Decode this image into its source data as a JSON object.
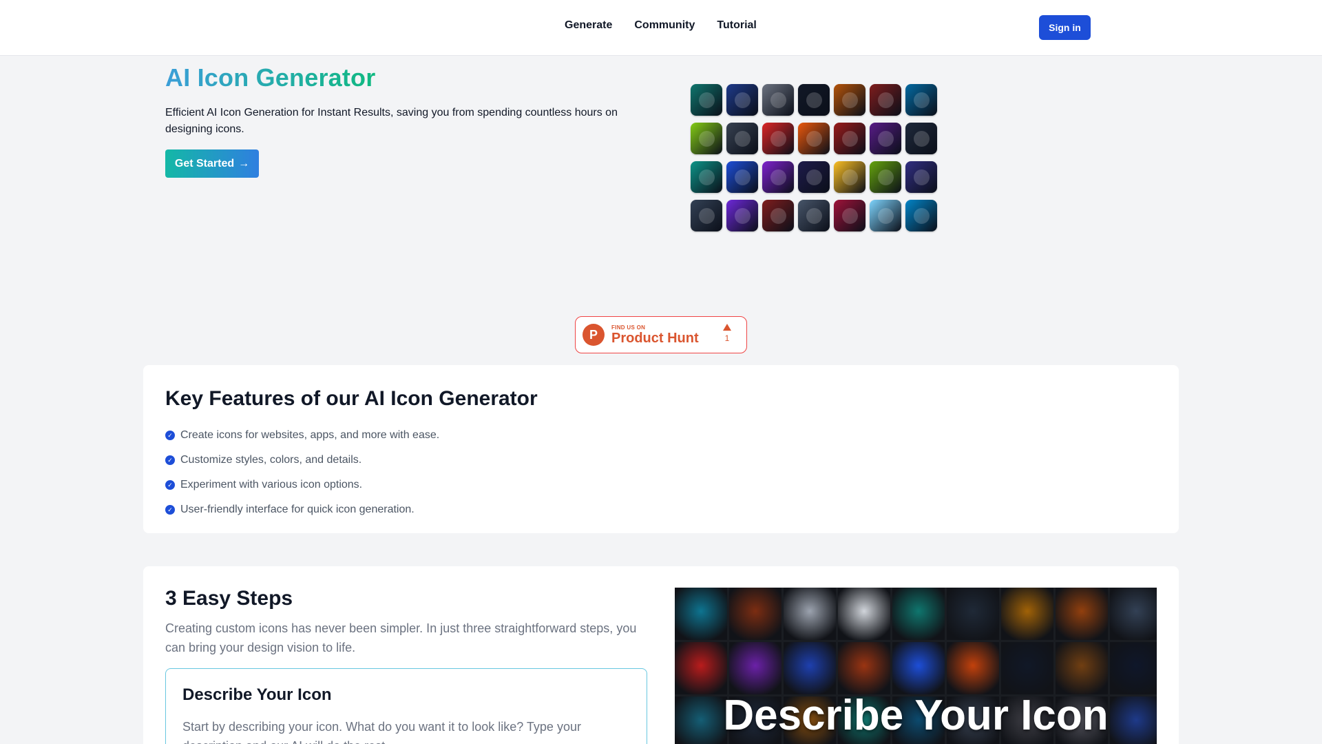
{
  "header": {
    "nav": [
      "Generate",
      "Community",
      "Tutorial"
    ],
    "signin_label": "Sign in"
  },
  "hero": {
    "title": "AI Icon Generator",
    "description": "Efficient AI Icon Generation for Instant Results, saving you from spending countless hours on designing icons.",
    "cta_label": "Get Started",
    "cta_arrow": "→",
    "icon_colors": [
      "#0f766e",
      "#1e3a8a",
      "#6b7280",
      "#111827",
      "#b45309",
      "#7f1d1d",
      "#0369a1",
      "#84cc16",
      "#374151",
      "#dc2626",
      "#ea580c",
      "#991b1b",
      "#581c87",
      "#1e293b",
      "#0d9488",
      "#1d4ed8",
      "#7e22ce",
      "#1e1b4b",
      "#fbbf24",
      "#65a30d",
      "#312e81",
      "#334155",
      "#6d28d9",
      "#7f1d1d",
      "#475569",
      "#9f1239",
      "#7dd3fc",
      "#0284c7"
    ]
  },
  "product_hunt": {
    "logo_letter": "P",
    "small_text": "FIND US ON",
    "big_text": "Product Hunt",
    "count": "1"
  },
  "features": {
    "title": "Key Features of our AI Icon Generator",
    "items": [
      "Create icons for websites, apps, and more with ease.",
      "Customize styles, colors, and details.",
      "Experiment with various icon options.",
      "User-friendly interface for quick icon generation."
    ]
  },
  "steps": {
    "title": "3 Easy Steps",
    "description": "Creating custom icons has never been simpler. In just three straightforward steps, you can bring your design vision to life.",
    "step1_title": "Describe Your Icon",
    "step1_text": "Start by describing your icon. What do you want it to look like? Type your description and our AI will do the rest.",
    "image_caption": "Describe Your Icon",
    "mosaic_colors": [
      "#0e7490",
      "#7c2d12",
      "#9ca3af",
      "#d1d5db",
      "#0f766e",
      "#1f2937",
      "#a16207",
      "#92400e",
      "#334155",
      "#b91c1c",
      "#6b21a8",
      "#1e40af",
      "#9a3412",
      "#1d4ed8",
      "#c2410c",
      "#111827",
      "#713f12",
      "#0f172a",
      "#155e75",
      "#1e293b",
      "#854d0e",
      "#0f766e",
      "#0c4a6e",
      "#374151",
      "#3f3f46",
      "#52525b",
      "#1e3a8a"
    ]
  }
}
